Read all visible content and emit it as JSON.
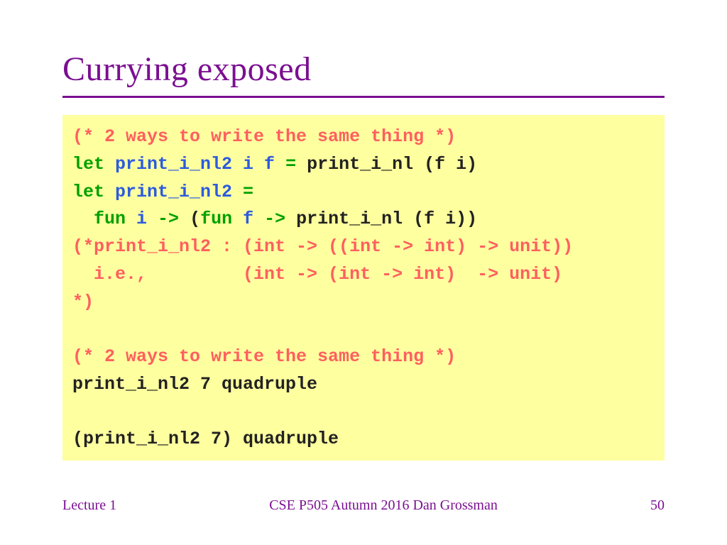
{
  "title": "Currying exposed",
  "code": [
    [
      {
        "cls": "c-comment",
        "text": "(* 2 ways to write the same thing *)"
      }
    ],
    [
      {
        "cls": "c-kw",
        "text": "let "
      },
      {
        "cls": "c-id",
        "text": "print_i_nl2 i f"
      },
      {
        "cls": "c-kw",
        "text": " = "
      },
      {
        "cls": "c-plain",
        "text": "print_i_nl (f i)"
      }
    ],
    [
      {
        "cls": "c-kw",
        "text": "let "
      },
      {
        "cls": "c-id",
        "text": "print_i_nl2"
      },
      {
        "cls": "c-kw",
        "text": " ="
      }
    ],
    [
      {
        "cls": "c-plain",
        "text": "  "
      },
      {
        "cls": "c-kw",
        "text": "fun "
      },
      {
        "cls": "c-id",
        "text": "i"
      },
      {
        "cls": "c-kw",
        "text": " -> "
      },
      {
        "cls": "c-plain",
        "text": "("
      },
      {
        "cls": "c-kw",
        "text": "fun "
      },
      {
        "cls": "c-id",
        "text": "f"
      },
      {
        "cls": "c-kw",
        "text": " -> "
      },
      {
        "cls": "c-plain",
        "text": "print_i_nl (f i))"
      }
    ],
    [
      {
        "cls": "c-comment",
        "text": "(*print_i_nl2 : (int -> ((int -> int) -> unit))"
      }
    ],
    [
      {
        "cls": "c-comment",
        "text": "  i.e.,         (int -> (int -> int)  -> unit)"
      }
    ],
    [
      {
        "cls": "c-comment",
        "text": "*)"
      }
    ],
    [
      {
        "cls": "c-plain",
        "text": ""
      }
    ],
    [
      {
        "cls": "c-comment",
        "text": "(* 2 ways to write the same thing *)"
      }
    ],
    [
      {
        "cls": "c-plain",
        "text": "print_i_nl2 7 quadruple"
      }
    ],
    [
      {
        "cls": "c-plain",
        "text": ""
      }
    ],
    [
      {
        "cls": "c-plain",
        "text": "(print_i_nl2 7) quadruple"
      }
    ]
  ],
  "footer": {
    "left": "Lecture 1",
    "center": "CSE P505 Autumn 2016  Dan Grossman",
    "right": "50"
  }
}
